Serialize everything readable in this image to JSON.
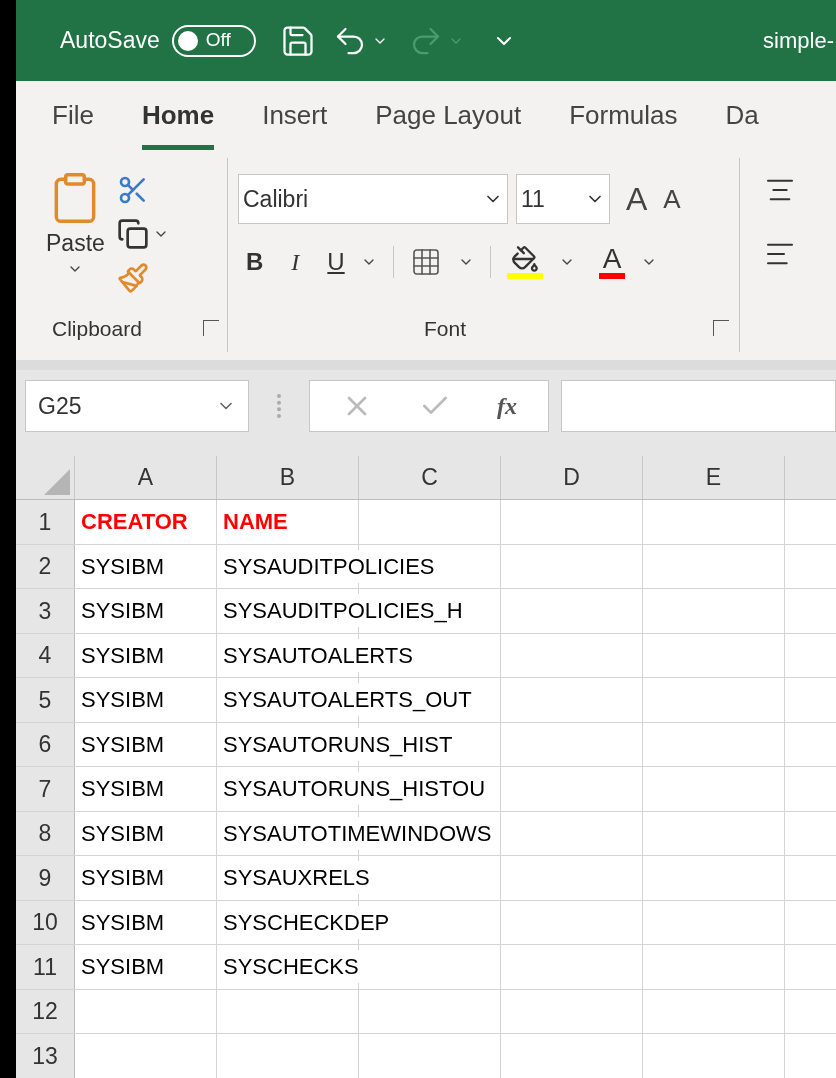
{
  "title_bar": {
    "autosave_label": "AutoSave",
    "autosave_toggle": {
      "on": false,
      "label": "Off"
    },
    "title": "simple-"
  },
  "menu_tabs": [
    {
      "label": "File",
      "selected": false
    },
    {
      "label": "Home",
      "selected": true
    },
    {
      "label": "Insert",
      "selected": false
    },
    {
      "label": "Page Layout",
      "selected": false
    },
    {
      "label": "Formulas",
      "selected": false
    },
    {
      "label": "Da",
      "selected": false
    }
  ],
  "ribbon": {
    "clipboard": {
      "paste_label": "Paste",
      "group_label": "Clipboard"
    },
    "font": {
      "font_name": "Calibri",
      "font_size": "11",
      "grow_label": "A",
      "shrink_label": "A",
      "bold_label": "B",
      "italic_label": "I",
      "underline_label": "U",
      "font_color_label": "A",
      "group_label": "Font"
    }
  },
  "formula_bar": {
    "name_box": "G25",
    "fx_label": "fx"
  },
  "sheet": {
    "columns": [
      "A",
      "B",
      "C",
      "D",
      "E"
    ],
    "rows": [
      {
        "number": "1",
        "cells": [
          "CREATOR",
          "NAME"
        ],
        "header": true
      },
      {
        "number": "2",
        "cells": [
          "SYSIBM",
          "SYSAUDITPOLICIES"
        ],
        "header": false
      },
      {
        "number": "3",
        "cells": [
          "SYSIBM",
          "SYSAUDITPOLICIES_H"
        ],
        "header": false
      },
      {
        "number": "4",
        "cells": [
          "SYSIBM",
          "SYSAUTOALERTS"
        ],
        "header": false
      },
      {
        "number": "5",
        "cells": [
          "SYSIBM",
          "SYSAUTOALERTS_OUT"
        ],
        "header": false
      },
      {
        "number": "6",
        "cells": [
          "SYSIBM",
          "SYSAUTORUNS_HIST"
        ],
        "header": false
      },
      {
        "number": "7",
        "cells": [
          "SYSIBM",
          "SYSAUTORUNS_HISTOU"
        ],
        "header": false
      },
      {
        "number": "8",
        "cells": [
          "SYSIBM",
          "SYSAUTOTIMEWINDOWS"
        ],
        "header": false
      },
      {
        "number": "9",
        "cells": [
          "SYSIBM",
          "SYSAUXRELS"
        ],
        "header": false
      },
      {
        "number": "10",
        "cells": [
          "SYSIBM",
          "SYSCHECKDEP"
        ],
        "header": false
      },
      {
        "number": "11",
        "cells": [
          "SYSIBM",
          "SYSCHECKS"
        ],
        "header": false
      },
      {
        "number": "12",
        "cells": []
      },
      {
        "number": "13",
        "cells": []
      }
    ]
  }
}
